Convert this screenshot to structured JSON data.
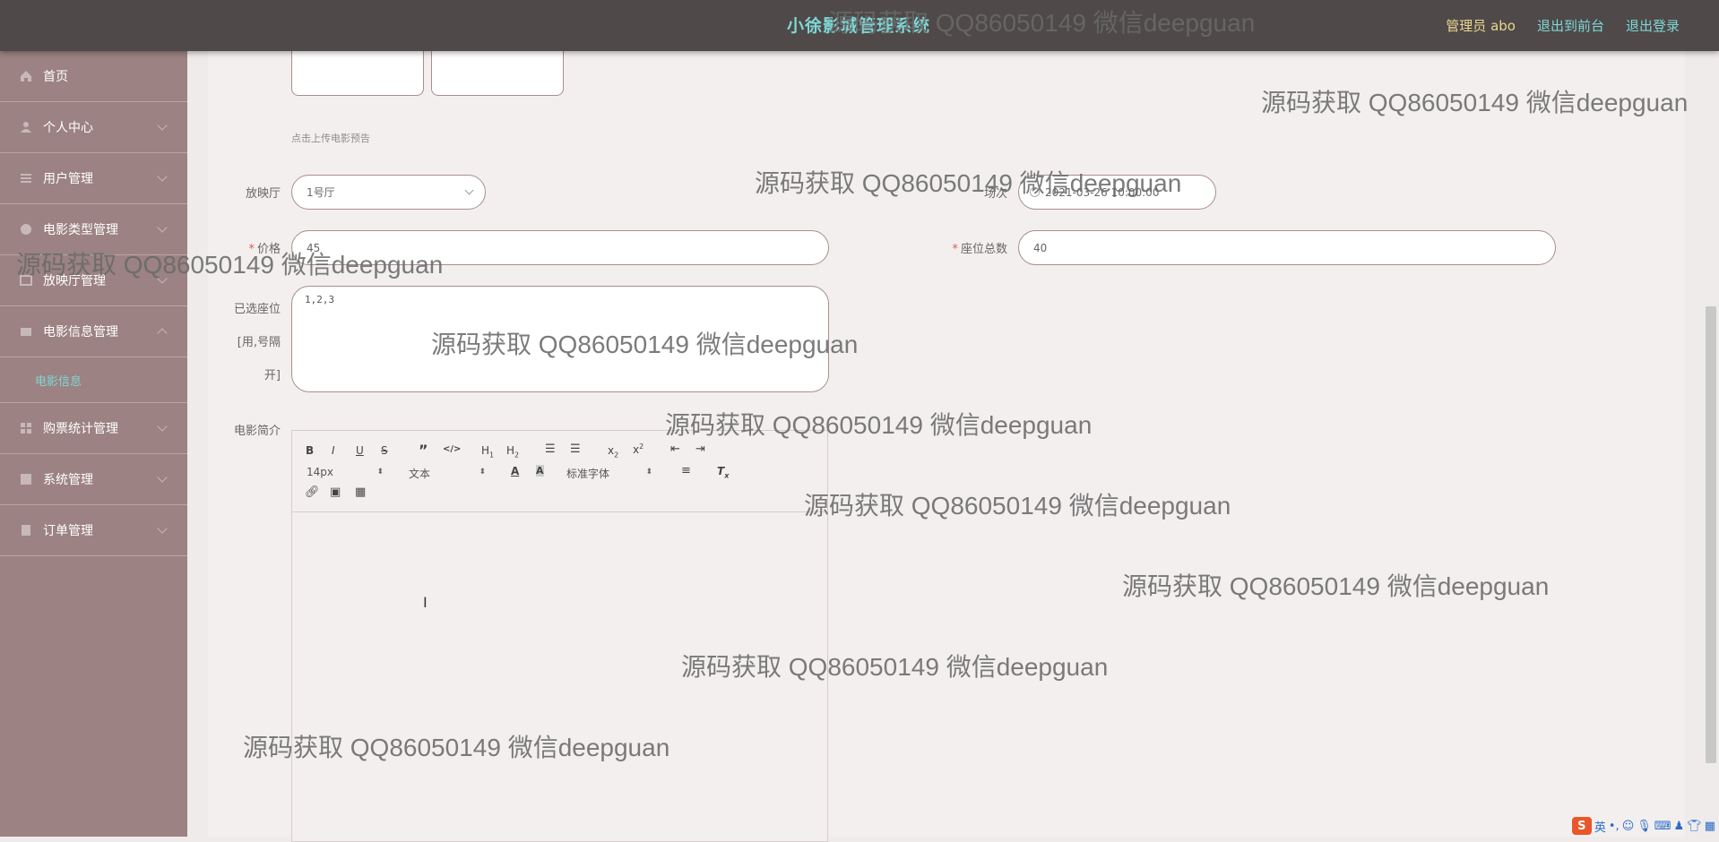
{
  "header": {
    "title": "小徐影城管理系统",
    "user_label": "管理员 abo",
    "front_link": "退出到前台",
    "logout_link": "退出登录"
  },
  "sidebar": {
    "items": [
      {
        "label": "首页",
        "icon": "home-icon",
        "chevron": false
      },
      {
        "label": "个人中心",
        "icon": "user-icon",
        "chevron": true
      },
      {
        "label": "用户管理",
        "icon": "list-icon",
        "chevron": true
      },
      {
        "label": "电影类型管理",
        "icon": "tag-icon",
        "chevron": true
      },
      {
        "label": "放映厅管理",
        "icon": "hall-icon",
        "chevron": true
      },
      {
        "label": "电影信息管理",
        "icon": "film-icon",
        "chevron": true,
        "expanded": true
      },
      {
        "label": "购票统计管理",
        "icon": "grid-icon",
        "chevron": true
      },
      {
        "label": "系统管理",
        "icon": "settings-icon",
        "chevron": true
      },
      {
        "label": "订单管理",
        "icon": "order-icon",
        "chevron": true
      }
    ],
    "sub_item": "电影信息"
  },
  "form": {
    "upload_hint": "点击上传电影预告",
    "hall_label": "放映厅",
    "hall_value": "1号厅",
    "session_label": "场次",
    "session_value": "2021-03-26 10:00:00",
    "price_label": "价格",
    "price_value": "45",
    "seats_total_label": "座位总数",
    "seats_total_value": "40",
    "selected_seats_label_1": "已选座位",
    "selected_seats_label_2": "[用,号隔",
    "selected_seats_label_3": "开]",
    "selected_seats_value": "1,2,3",
    "intro_label": "电影简介"
  },
  "editor": {
    "font_size": "14px",
    "paragraph": "文本",
    "font_family": "标准字体"
  },
  "watermark": "源码获取 QQ86050149 微信deepguan",
  "tray": {
    "ime_logo": "S",
    "ime_lang": "英"
  },
  "colors": {
    "header_bg": "#4f4949",
    "sidebar_bg": "#9c8282",
    "accent": "#7ed7d5",
    "user_gold": "#e9d78e",
    "required": "#e0565a"
  }
}
